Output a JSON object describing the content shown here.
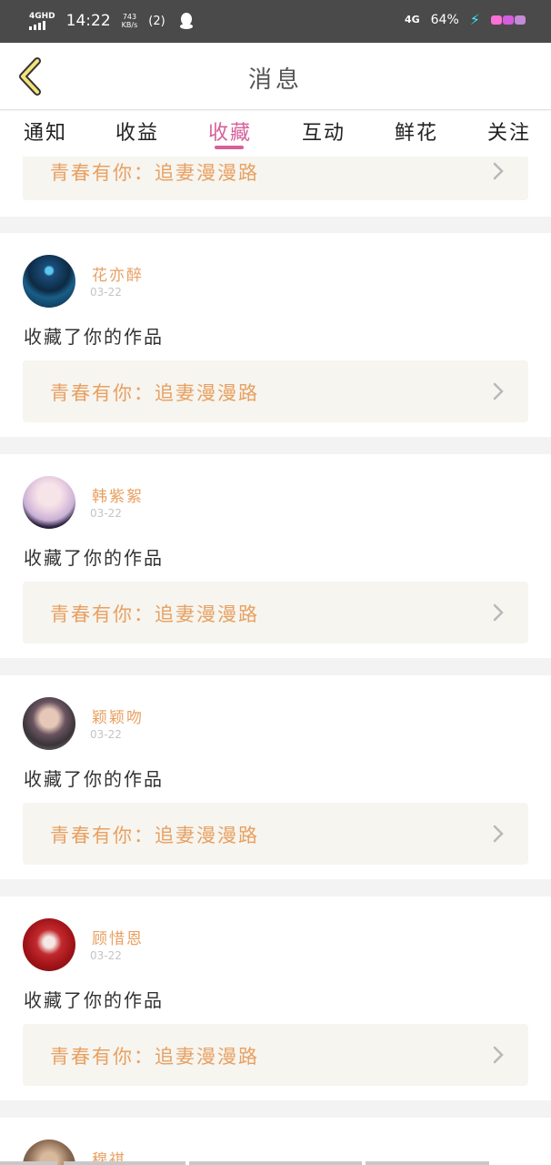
{
  "status": {
    "network": "4GHD",
    "time": "14:22",
    "speed_value": "743",
    "speed_unit": "KB/s",
    "hotspot": "(2)",
    "right_network": "4G",
    "battery": "64%"
  },
  "header": {
    "title": "消息"
  },
  "tabs": [
    {
      "label": "通知"
    },
    {
      "label": "收益"
    },
    {
      "label": "收藏"
    },
    {
      "label": "互动"
    },
    {
      "label": "鲜花"
    },
    {
      "label": "关注"
    }
  ],
  "active_tab": "收藏",
  "top_partial": {
    "work_title": "青春有你：追妻漫漫路"
  },
  "messages": [
    {
      "name": "花亦醉",
      "date": "03-22",
      "action": "收藏了你的作品",
      "work_title": "青春有你：追妻漫漫路"
    },
    {
      "name": "韩紫絮",
      "date": "03-22",
      "action": "收藏了你的作品",
      "work_title": "青春有你：追妻漫漫路"
    },
    {
      "name": "颖颖吻",
      "date": "03-22",
      "action": "收藏了你的作品",
      "work_title": "青春有你：追妻漫漫路"
    },
    {
      "name": "顾惜恩",
      "date": "03-22",
      "action": "收藏了你的作品",
      "work_title": "青春有你：追妻漫漫路"
    },
    {
      "name": "穆祺",
      "date": "",
      "action": "",
      "work_title": ""
    }
  ],
  "colors": {
    "accent_pink": "#d6619a",
    "name_orange": "#e8a062",
    "link_bg": "#f6f5ef",
    "status_bar": "#4a4a4a"
  },
  "icons": {
    "back": "chevron-left-icon",
    "work_link": "chevron-right-icon",
    "charging": "lightning-icon",
    "notification": "qq-penguin-icon"
  }
}
